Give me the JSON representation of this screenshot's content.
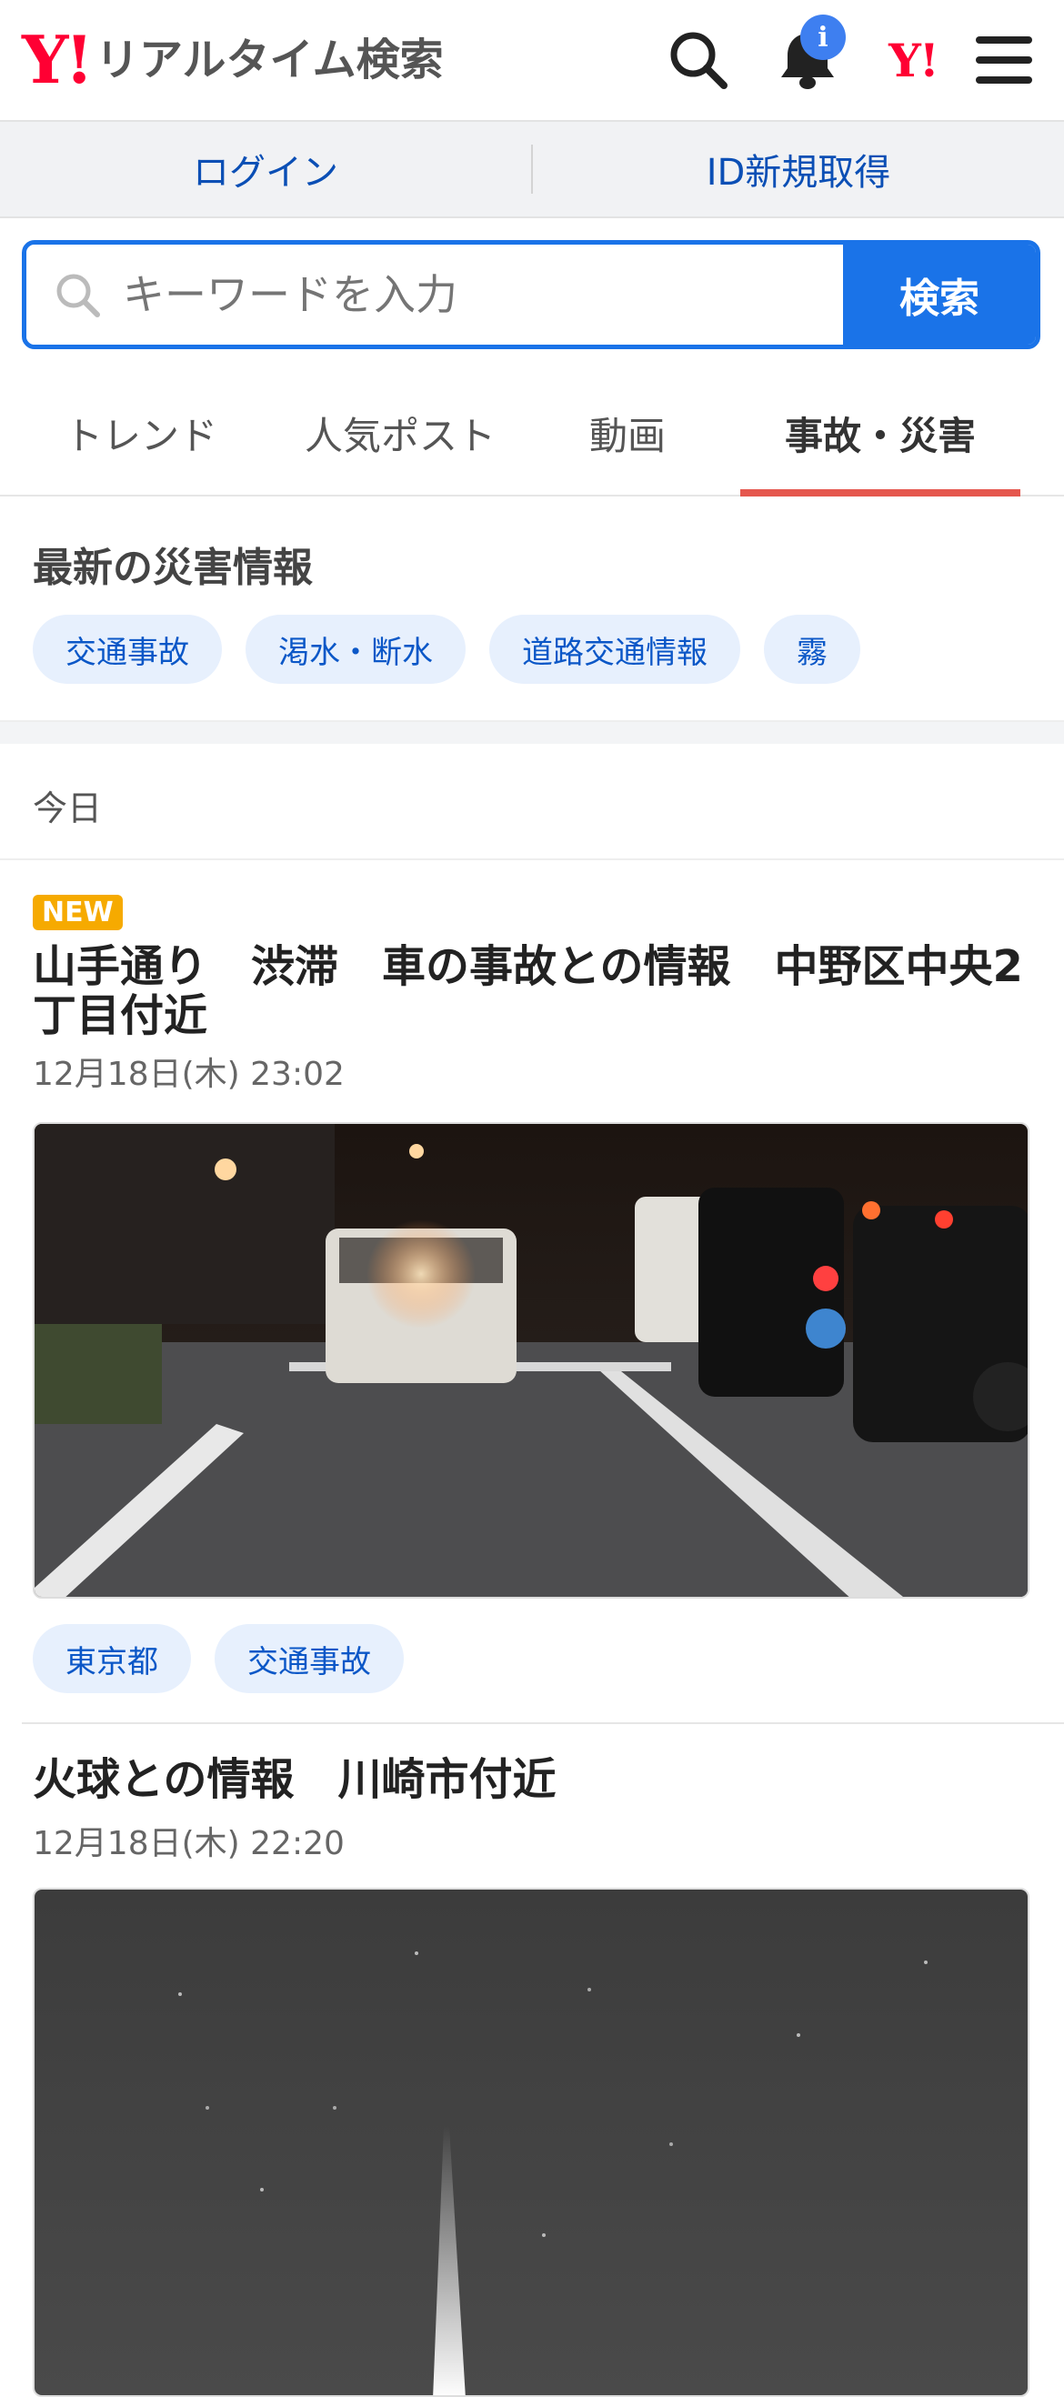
{
  "header": {
    "logo_mark": "Y!",
    "logo_text": "リアルタイム検索",
    "notification_badge": "i",
    "yahoo_mark": "Y!"
  },
  "auth": {
    "login": "ログイン",
    "register": "ID新規取得"
  },
  "search": {
    "placeholder": "キーワードを入力",
    "button": "検索"
  },
  "tabs": [
    {
      "label": "トレンド",
      "active": false
    },
    {
      "label": "人気ポスト",
      "active": false
    },
    {
      "label": "動画",
      "active": false
    },
    {
      "label": "事故・災害",
      "active": true
    }
  ],
  "disaster": {
    "title": "最新の災害情報",
    "chips": [
      "交通事故",
      "渇水・断水",
      "道路交通情報",
      "霧"
    ]
  },
  "today_label": "今日",
  "articles": [
    {
      "badge": "NEW",
      "title": "山手通り　渋滞　車の事故との情報　中野区中央2丁目付近",
      "date": "12月18日(木) 23:02",
      "tags": [
        "東京都",
        "交通事故"
      ]
    },
    {
      "title": "火球との情報　川崎市付近",
      "date": "12月18日(木) 22:20"
    }
  ],
  "colors": {
    "accent": "#1a73e8",
    "tab_underline": "#e5574e",
    "brand": "#ff0033",
    "new_badge": "#f6aa00"
  }
}
